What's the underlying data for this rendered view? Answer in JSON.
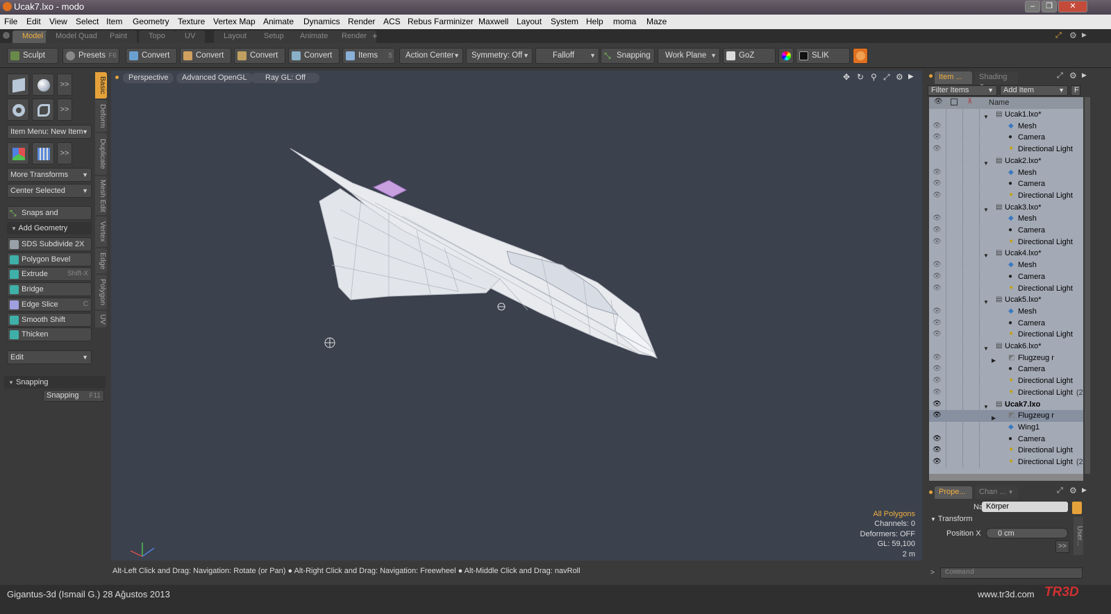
{
  "window": {
    "title": "Ucak7.lxo - modo",
    "controls": [
      "minimize",
      "restore",
      "close"
    ]
  },
  "menubar": [
    "File",
    "Edit",
    "View",
    "Select",
    "Item",
    "Geometry",
    "Texture",
    "Vertex Map",
    "Animate",
    "Dynamics",
    "Render",
    "ACS",
    "Rebus Farminizer",
    "Maxwell",
    "Layout",
    "System",
    "Help",
    "moma",
    "Maze"
  ],
  "tabs": {
    "items": [
      "Model",
      "Model Quad",
      "Paint",
      "Topo",
      "UV",
      "Layout",
      "Setup",
      "Animate",
      "Render"
    ],
    "active": "Model",
    "add": "+"
  },
  "toolbar": {
    "sculpt": "Sculpt",
    "presets": "Presets",
    "presets_hotkey": "F6",
    "convert": [
      "Convert",
      "Convert",
      "Convert",
      "Convert"
    ],
    "items": "Items",
    "items_hotkey": "5",
    "action_center": "Action Center",
    "symmetry": "Symmetry: Off",
    "falloff": "Falloff",
    "snapping": "Snapping",
    "work_plane": "Work Plane",
    "goz": "GoZ",
    "slik": "SLIK"
  },
  "left": {
    "item_menu": "Item Menu: New Item",
    "more_transforms": "More Transforms",
    "center_selected": "Center Selected",
    "snaps": "Snaps and Precision",
    "add_geometry": "Add Geometry",
    "tools": [
      {
        "label": "SDS Subdivide 2X",
        "hotkey": "",
        "color": "#9aa0a8"
      },
      {
        "label": "Polygon Bevel",
        "hotkey": "",
        "color": "#3fb0a8"
      },
      {
        "label": "Extrude",
        "hotkey": "Shift-X",
        "color": "#3fb0a8"
      },
      {
        "label": "Bridge",
        "hotkey": "",
        "color": "#3fb0a8"
      },
      {
        "label": "Edge Slice",
        "hotkey": "C",
        "color": "#a0a0e0"
      },
      {
        "label": "Smooth Shift",
        "hotkey": "",
        "color": "#3fb0a8"
      },
      {
        "label": "Thicken",
        "hotkey": "",
        "color": "#3fb0a8"
      }
    ],
    "edit": "Edit",
    "snapping_section": "Snapping",
    "snapping_btn": "Snapping",
    "snapping_hotkey": "F11",
    "more_label": ">>"
  },
  "vtabs": [
    "Basic",
    "Deform",
    "Duplicate",
    "Mesh Edit",
    "Vertex",
    "Edge",
    "Polygon",
    "UV"
  ],
  "viewport": {
    "view": "Perspective",
    "shading": "Advanced OpenGL",
    "raygl": "Ray GL: Off",
    "stats": {
      "selection": "All Polygons",
      "channels": "Channels: 0",
      "deformers": "Deformers: OFF",
      "gl": "GL: 59,100",
      "scale": "2 m"
    },
    "background": "#3b414d",
    "accent": "#f0b040"
  },
  "status": "Alt-Left Click and Drag: Navigation: Rotate (or Pan) ● Alt-Right Click and Drag: Navigation: Freewheel ● Alt-Middle Click and Drag: navRoll",
  "right": {
    "tabs": [
      "Item ...",
      "Shading"
    ],
    "filter": "Filter Items",
    "add_item": "Add Item",
    "f_btn": "F",
    "name_header": "Name",
    "tree": [
      {
        "label": "Ucak1.lxo*",
        "depth": 0,
        "type": "scene",
        "twirl": "open",
        "eye": ""
      },
      {
        "label": "Mesh",
        "depth": 1,
        "type": "mesh",
        "twirl": "",
        "eye": "dim"
      },
      {
        "label": "Camera",
        "depth": 1,
        "type": "camera",
        "twirl": "",
        "eye": "dim"
      },
      {
        "label": "Directional Light",
        "depth": 1,
        "type": "light",
        "twirl": "",
        "eye": "dim"
      },
      {
        "label": "Ucak2.lxo*",
        "depth": 0,
        "type": "scene",
        "twirl": "open",
        "eye": ""
      },
      {
        "label": "Mesh",
        "depth": 1,
        "type": "mesh",
        "twirl": "",
        "eye": "dim"
      },
      {
        "label": "Camera",
        "depth": 1,
        "type": "camera",
        "twirl": "",
        "eye": "dim"
      },
      {
        "label": "Directional Light",
        "depth": 1,
        "type": "light",
        "twirl": "",
        "eye": "dim"
      },
      {
        "label": "Ucak3.lxo*",
        "depth": 0,
        "type": "scene",
        "twirl": "open",
        "eye": ""
      },
      {
        "label": "Mesh",
        "depth": 1,
        "type": "mesh",
        "twirl": "",
        "eye": "dim"
      },
      {
        "label": "Camera",
        "depth": 1,
        "type": "camera",
        "twirl": "",
        "eye": "dim"
      },
      {
        "label": "Directional Light",
        "depth": 1,
        "type": "light",
        "twirl": "",
        "eye": "dim"
      },
      {
        "label": "Ucak4.lxo*",
        "depth": 0,
        "type": "scene",
        "twirl": "open",
        "eye": ""
      },
      {
        "label": "Mesh",
        "depth": 1,
        "type": "mesh",
        "twirl": "",
        "eye": "dim"
      },
      {
        "label": "Camera",
        "depth": 1,
        "type": "camera",
        "twirl": "",
        "eye": "dim"
      },
      {
        "label": "Directional Light",
        "depth": 1,
        "type": "light",
        "twirl": "",
        "eye": "dim"
      },
      {
        "label": "Ucak5.lxo*",
        "depth": 0,
        "type": "scene",
        "twirl": "open",
        "eye": ""
      },
      {
        "label": "Mesh",
        "depth": 1,
        "type": "mesh",
        "twirl": "",
        "eye": "dim"
      },
      {
        "label": "Camera",
        "depth": 1,
        "type": "camera",
        "twirl": "",
        "eye": "dim"
      },
      {
        "label": "Directional Light",
        "depth": 1,
        "type": "light",
        "twirl": "",
        "eye": "dim"
      },
      {
        "label": "Ucak6.lxo*",
        "depth": 0,
        "type": "scene",
        "twirl": "open",
        "eye": ""
      },
      {
        "label": "Flugzeug r",
        "depth": 1,
        "type": "group",
        "twirl": "closed",
        "eye": "dim"
      },
      {
        "label": "Camera",
        "depth": 1,
        "type": "camera",
        "twirl": "",
        "eye": "dim"
      },
      {
        "label": "Directional Light",
        "depth": 1,
        "type": "light",
        "twirl": "",
        "eye": "dim"
      },
      {
        "label": "Directional Light",
        "depth": 1,
        "type": "light",
        "twirl": "",
        "eye": "dim",
        "suffix": "(2"
      },
      {
        "label": "Ucak7.lxo",
        "depth": 0,
        "type": "scene",
        "twirl": "open",
        "eye": "on",
        "bold": true
      },
      {
        "label": "Flugzeug r",
        "depth": 1,
        "type": "group",
        "twirl": "closed",
        "eye": "on",
        "selected": true
      },
      {
        "label": "Wing1",
        "depth": 1,
        "type": "mesh",
        "twirl": "",
        "eye": ""
      },
      {
        "label": "Camera",
        "depth": 1,
        "type": "camera",
        "twirl": "",
        "eye": "on"
      },
      {
        "label": "Directional Light",
        "depth": 1,
        "type": "light",
        "twirl": "",
        "eye": "on"
      },
      {
        "label": "Directional Light",
        "depth": 1,
        "type": "light",
        "twirl": "",
        "eye": "on",
        "suffix": "(2"
      }
    ],
    "props_tabs": [
      "Prope...",
      "Chan ..."
    ],
    "name_label": "Name",
    "name_value": "Körper",
    "transform_label": "Transform",
    "posx_label": "Position X",
    "posx_value": "0 cm",
    "user_tab": "User...",
    "command_placeholder": "Command"
  },
  "footer": {
    "left": "Gigantus-3d (Ismail G.)  28 Ağustos 2013",
    "right": "www.tr3d.com",
    "logo": "TR3D"
  }
}
